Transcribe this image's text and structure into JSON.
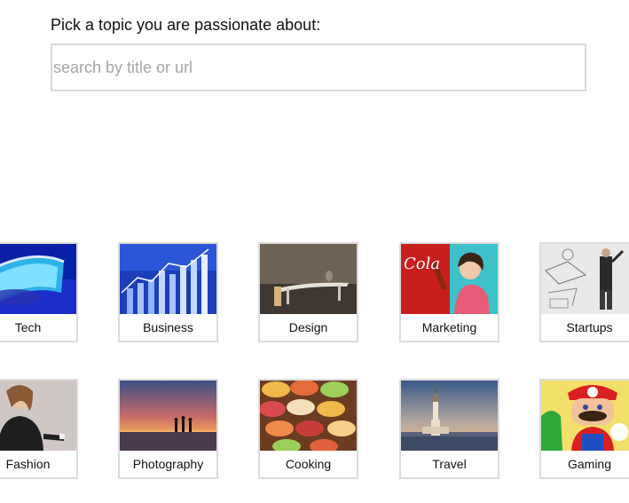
{
  "heading": "Pick a topic you are passionate about:",
  "search": {
    "placeholder": "search by title or url",
    "value": ""
  },
  "topics": [
    {
      "label": "Tech"
    },
    {
      "label": "Business"
    },
    {
      "label": "Design"
    },
    {
      "label": "Marketing"
    },
    {
      "label": "Startups"
    },
    {
      "label": "Fashion"
    },
    {
      "label": "Photography"
    },
    {
      "label": "Cooking"
    },
    {
      "label": "Travel"
    },
    {
      "label": "Gaming"
    }
  ],
  "colors": {
    "tile_border": "#dcdcdc",
    "search_border": "#d9d9d9",
    "placeholder": "#a6a6a6"
  }
}
